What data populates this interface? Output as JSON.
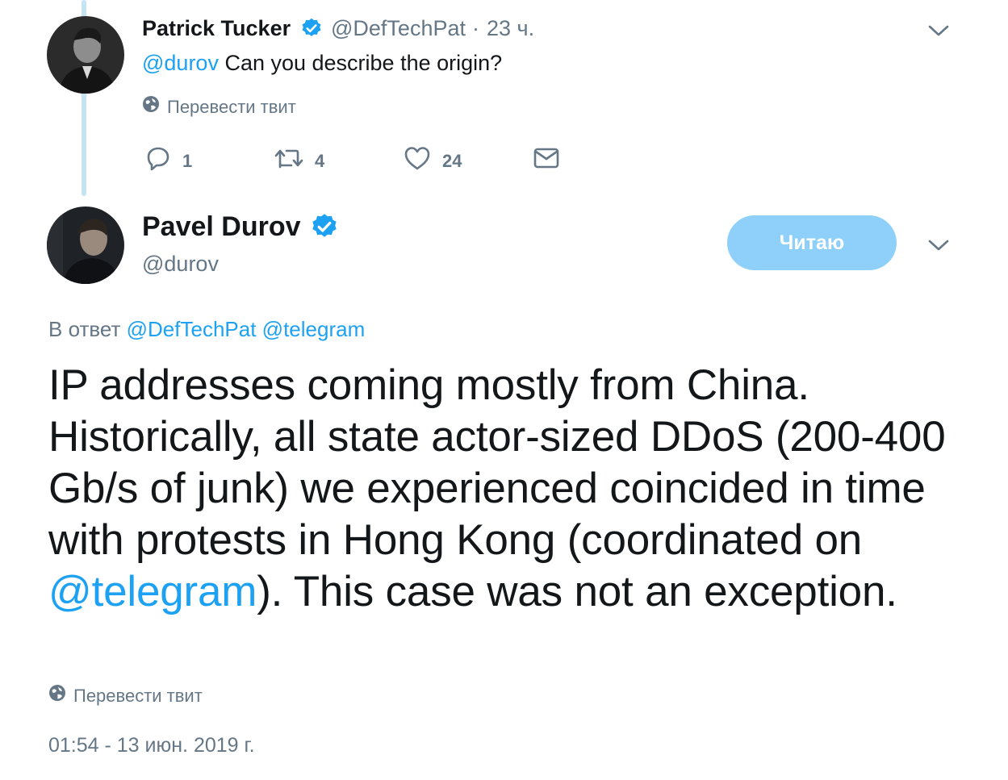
{
  "reply_tweet": {
    "author_name": "Patrick Tucker",
    "author_handle": "@DefTechPat",
    "separator": "·",
    "time_ago": "23 ч.",
    "mention": "@durov",
    "text": " Can you describe the origin?",
    "translate_label": "Перевести твит",
    "actions": {
      "reply_count": "1",
      "retweet_count": "4",
      "like_count": "24"
    }
  },
  "main_tweet": {
    "author_name": "Pavel Durov",
    "author_handle": "@durov",
    "follow_label": "Читаю",
    "in_reply_prefix": "В ответ",
    "in_reply_mentions": [
      "@DefTechPat",
      "@telegram"
    ],
    "text_part1": "IP addresses coming mostly from China. Historically, all state actor-sized DDoS (200-400 Gb/s of junk) we experienced coincided in time with protests in Hong Kong (coordinated on ",
    "text_mention": "@telegram",
    "text_part2": "). This case was not an exception.",
    "translate_label": "Перевести твит",
    "timestamp": "01:54 - 13 июн. 2019 г."
  },
  "colors": {
    "accent": "#1da1f2",
    "muted": "#657786",
    "text": "#14171a",
    "thread_line": "#c4e4f5",
    "follow_button_bg": "#8ed0f9"
  },
  "icons": [
    "verified-badge-icon",
    "chevron-down-icon",
    "globe-icon",
    "reply-icon",
    "retweet-icon",
    "like-icon",
    "direct-message-icon"
  ]
}
